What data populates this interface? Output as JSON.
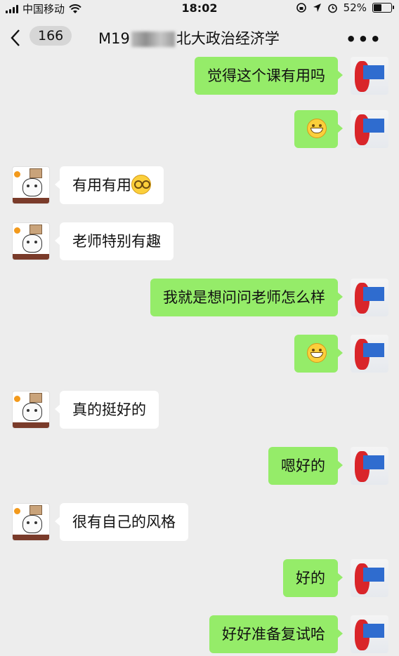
{
  "status_bar": {
    "carrier": "中国移动",
    "time": "18:02",
    "battery_percent": "52%",
    "battery_level": 0.52,
    "icons": [
      "signal-bars-icon",
      "wifi-icon",
      "orientation-lock-icon",
      "location-icon",
      "alarm-icon",
      "battery-icon"
    ]
  },
  "nav": {
    "back_icon": "chevron-left-icon",
    "unread_count": "166",
    "title_prefix": "M19",
    "title_suffix": "北大政治经济学",
    "more_icon": "more-horizontal-icon"
  },
  "colors": {
    "background": "#ededed",
    "bubble_me": "#95ec69",
    "bubble_other": "#ffffff"
  },
  "messages": [
    {
      "from": "me",
      "text": "觉得这个课有用吗"
    },
    {
      "from": "me",
      "text": "",
      "emoji": "grinning-face-emoji"
    },
    {
      "from": "other",
      "text": "有用有用",
      "emoji": "nerd-face-emoji"
    },
    {
      "from": "other",
      "text": "老师特别有趣"
    },
    {
      "from": "me",
      "text": "我就是想问问老师怎么样"
    },
    {
      "from": "me",
      "text": "",
      "emoji": "grinning-face-emoji"
    },
    {
      "from": "other",
      "text": "真的挺好的"
    },
    {
      "from": "me",
      "text": "嗯好的"
    },
    {
      "from": "other",
      "text": "很有自己的风格"
    },
    {
      "from": "me",
      "text": "好的"
    },
    {
      "from": "me",
      "text": "好好准备复试哈"
    }
  ]
}
